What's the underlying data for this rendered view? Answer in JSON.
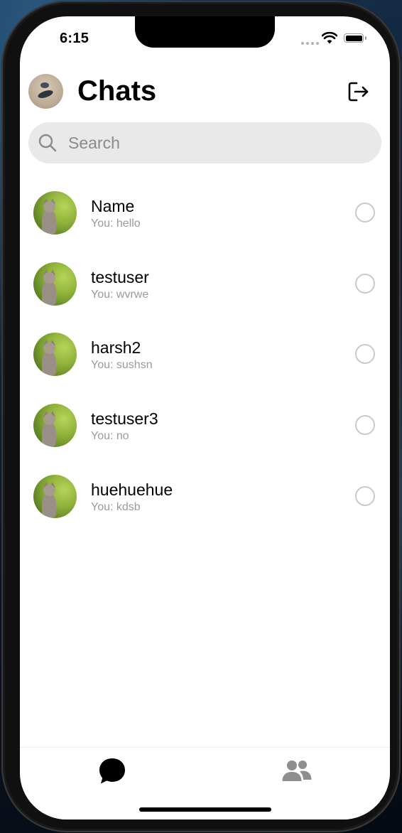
{
  "status_bar": {
    "time": "6:15"
  },
  "header": {
    "title": "Chats"
  },
  "search": {
    "placeholder": "Search",
    "value": ""
  },
  "chats": [
    {
      "name": "Name",
      "preview": "You: hello"
    },
    {
      "name": "testuser",
      "preview": "You: wvrwe"
    },
    {
      "name": "harsh2",
      "preview": "You: sushsn"
    },
    {
      "name": "testuser3",
      "preview": "You: no"
    },
    {
      "name": "huehuehue",
      "preview": "You: kdsb"
    }
  ],
  "tab_bar": {
    "tabs": [
      {
        "icon": "chat-bubble-icon",
        "active": true
      },
      {
        "icon": "people-icon",
        "active": false
      }
    ]
  },
  "colors": {
    "background": "#ffffff",
    "search_background": "#e9e9e9",
    "secondary_text": "#9b9b9b",
    "radio_border": "#c9c9c9",
    "tab_active": "#000000",
    "tab_inactive": "#8e8e8e"
  }
}
